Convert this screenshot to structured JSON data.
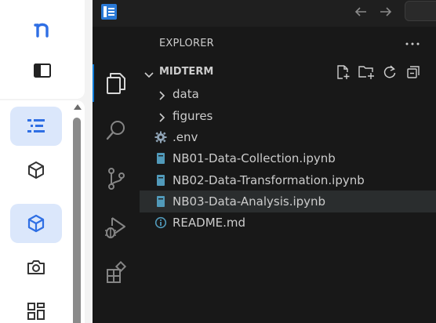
{
  "host_sidebar": {
    "logo_icon": "notion-like-n-logo-icon",
    "items": [
      {
        "icon": "list-view-icon",
        "active": true
      },
      {
        "icon": "cube-outline-icon",
        "active": false
      },
      {
        "icon": "cube-outline-icon",
        "active": true
      },
      {
        "icon": "camera-icon",
        "active": false
      },
      {
        "icon": "dashboard-grid-icon",
        "active": false
      }
    ],
    "accent_color": "#2f6fe4"
  },
  "vscode": {
    "activity_icons": [
      "explorer-icon",
      "search-icon",
      "source-control-icon",
      "run-debug-icon",
      "extensions-icon"
    ],
    "explorer": {
      "title": "EXPLORER",
      "more_label": "···",
      "folder": "MIDTERM",
      "items": [
        {
          "label": "data",
          "kind": "folder"
        },
        {
          "label": "figures",
          "kind": "folder"
        },
        {
          "label": ".env",
          "kind": "env"
        },
        {
          "label": "NB01-Data-Collection.ipynb",
          "kind": "notebook"
        },
        {
          "label": "NB02-Data-Transformation.ipynb",
          "kind": "notebook"
        },
        {
          "label": "NB03-Data-Analysis.ipynb",
          "kind": "notebook"
        },
        {
          "label": "README.md",
          "kind": "info"
        }
      ]
    },
    "colors": {
      "notebook": "#519aba",
      "accent": "#0078d4"
    }
  }
}
